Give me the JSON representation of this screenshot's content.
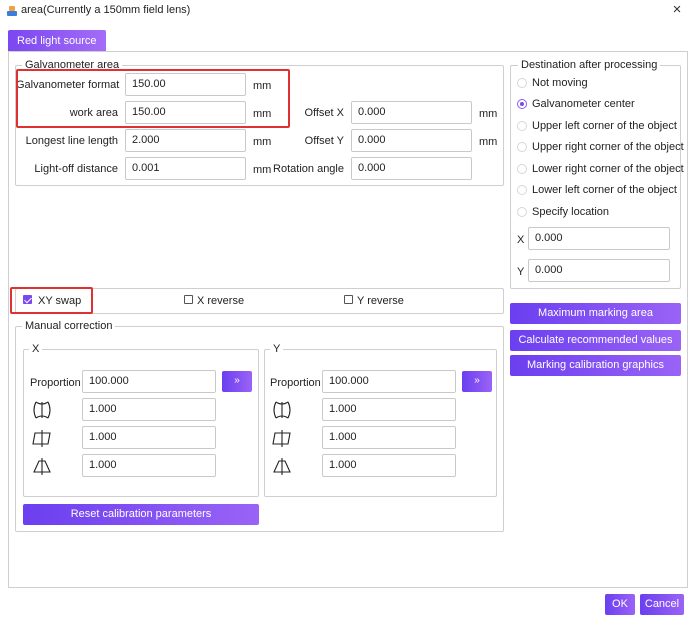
{
  "window": {
    "title": "area(Currently a 150mm field lens)",
    "close_glyph": "×"
  },
  "tabs": [
    {
      "label": "Red light source",
      "active": true
    }
  ],
  "galvanometer_area": {
    "legend": "Galvanometer area",
    "format_label": "Galvanometer format",
    "format_value": "150.00",
    "work_area_label": "work area",
    "work_area_value": "150.00",
    "longest_line_label": "Longest line length",
    "longest_line_value": "2.000",
    "light_off_label": "Light-off distance",
    "light_off_value": "0.001",
    "offset_x_label": "Offset X",
    "offset_x_value": "0.000",
    "offset_y_label": "Offset Y",
    "offset_y_value": "0.000",
    "rotation_label": "Rotation angle",
    "rotation_value": "0.000",
    "unit": "mm"
  },
  "destination": {
    "legend": "Destination after processing",
    "options": [
      {
        "label": "Not moving",
        "selected": false
      },
      {
        "label": "Galvanometer center",
        "selected": true
      },
      {
        "label": "Upper left corner of the object",
        "selected": false
      },
      {
        "label": "Upper right corner of the object",
        "selected": false
      },
      {
        "label": "Lower right corner of the object",
        "selected": false
      },
      {
        "label": "Lower left corner of the object",
        "selected": false
      },
      {
        "label": "Specify location",
        "selected": false
      }
    ],
    "x_label": "X",
    "x_value": "0.000",
    "y_label": "Y",
    "y_value": "0.000"
  },
  "axis_options": {
    "xy_swap": {
      "label": "XY swap",
      "checked": true
    },
    "x_reverse": {
      "label": "X reverse",
      "checked": false
    },
    "y_reverse": {
      "label": "Y reverse",
      "checked": false
    }
  },
  "side_buttons": {
    "max_marking": "Maximum marking area",
    "calc_recommended": "Calculate recommended values",
    "marking_calibration": "Marking calibration graphics"
  },
  "manual_correction": {
    "legend": "Manual correction",
    "x": {
      "legend": "X",
      "proportion_label": "Proportion",
      "proportion_value": "100.000",
      "barrel_value": "1.000",
      "trapezoid_value": "1.000",
      "parallelogram_value": "1.000"
    },
    "y": {
      "legend": "Y",
      "proportion_label": "Proportion",
      "proportion_value": "100.000",
      "barrel_value": "1.000",
      "trapezoid_value": "1.000",
      "parallelogram_value": "1.000"
    },
    "arrow_glyph": "»",
    "reset_label": "Reset calibration parameters"
  },
  "footer": {
    "ok_label": "OK",
    "cancel_label": "Cancel"
  },
  "colors": {
    "accent": "#7b47f0",
    "highlight": "#e03131"
  },
  "icons": [
    "app-icon",
    "close-icon",
    "barrel-distortion-icon",
    "trapezoid-distortion-icon",
    "parallelogram-distortion-icon",
    "double-arrow-icon"
  ]
}
